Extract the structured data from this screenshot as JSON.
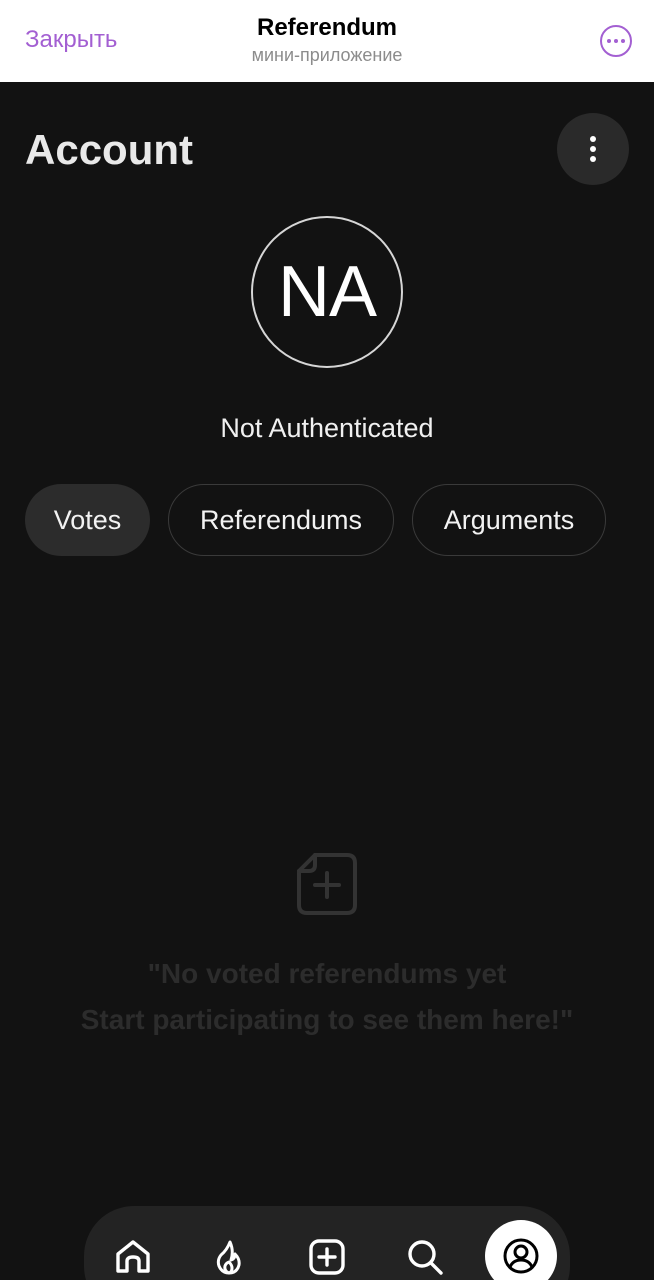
{
  "topbar": {
    "close_label": "Закрыть",
    "title": "Referendum",
    "subtitle": "мини-приложение",
    "more_icon": "more-horizontal-icon",
    "accent_color": "#a35fd2"
  },
  "header": {
    "title": "Account",
    "menu_icon": "more-vertical-icon"
  },
  "profile": {
    "initials": "NA",
    "status": "Not Authenticated"
  },
  "tabs": [
    {
      "label": "Votes",
      "active": true
    },
    {
      "label": "Referendums",
      "active": false
    },
    {
      "label": "Arguments",
      "active": false
    }
  ],
  "empty_state": {
    "icon": "add-note-icon",
    "line1": "\"No voted referendums yet",
    "line2": "Start participating to see them here!\""
  },
  "bottom_nav": {
    "items": [
      {
        "icon": "home-icon",
        "active": false
      },
      {
        "icon": "flame-icon",
        "active": false
      },
      {
        "icon": "add-square-icon",
        "active": false
      },
      {
        "icon": "search-icon",
        "active": false
      },
      {
        "icon": "account-icon",
        "active": true
      }
    ]
  },
  "colors": {
    "background": "#121212",
    "surface": "#2c2c2c",
    "text": "#f2f2f2"
  }
}
